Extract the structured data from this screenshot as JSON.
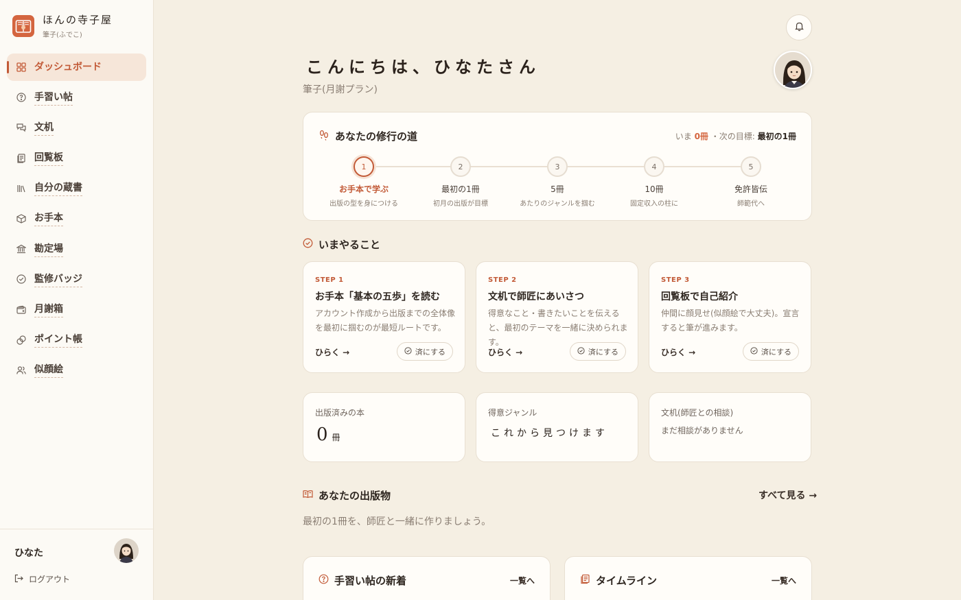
{
  "brand": {
    "name": "ほんの寺子屋",
    "subtitle": "筆子(ふでこ)"
  },
  "sidebar": {
    "items": [
      {
        "label": "ダッシュボード",
        "icon": "dashboard-icon",
        "active": true
      },
      {
        "label": "手習い帖",
        "icon": "question-bubble-icon"
      },
      {
        "label": "文机",
        "icon": "chat-bubbles-icon"
      },
      {
        "label": "回覧板",
        "icon": "documents-icon"
      },
      {
        "label": "自分の蔵書",
        "icon": "bookshelf-icon"
      },
      {
        "label": "お手本",
        "icon": "cube-icon"
      },
      {
        "label": "勘定場",
        "icon": "bank-icon"
      },
      {
        "label": "監修バッジ",
        "icon": "check-circle-icon"
      },
      {
        "label": "月謝箱",
        "icon": "wallet-icon"
      },
      {
        "label": "ポイント帳",
        "icon": "coins-icon"
      },
      {
        "label": "似顔絵",
        "icon": "users-icon"
      }
    ],
    "user_name": "ひなた",
    "logout_label": "ログアウト"
  },
  "header": {
    "greeting": "こんにちは、ひなたさん",
    "plan": "筆子(月謝プラン)"
  },
  "path": {
    "title": "あなたの修行の道",
    "status_prefix": "いま",
    "status_count": "0冊",
    "status_sep": "・次の目標:",
    "status_goal": "最初の1冊",
    "milestones": [
      {
        "num": "1",
        "title": "お手本で学ぶ",
        "sub": "出版の型を身につける"
      },
      {
        "num": "2",
        "title": "最初の1冊",
        "sub": "初月の出版が目標"
      },
      {
        "num": "3",
        "title": "5冊",
        "sub": "あたりのジャンルを掴む"
      },
      {
        "num": "4",
        "title": "10冊",
        "sub": "固定収入の柱に"
      },
      {
        "num": "5",
        "title": "免許皆伝",
        "sub": "師範代へ"
      }
    ],
    "current_step": 1
  },
  "todo": {
    "title": "いまやること",
    "steps": [
      {
        "label": "STEP 1",
        "title": "お手本「基本の五歩」を読む",
        "desc": "アカウント作成から出版までの全体像を最初に掴むのが最短ルートです。",
        "open": "ひらく →",
        "done": "済にする"
      },
      {
        "label": "STEP 2",
        "title": "文机で師匠にあいさつ",
        "desc": "得意なこと・書きたいことを伝えると、最初のテーマを一緒に決められます。",
        "open": "ひらく →",
        "done": "済にする"
      },
      {
        "label": "STEP 3",
        "title": "回覧板で自己紹介",
        "desc": "仲間に顔見せ(似顔絵で大丈夫)。宣言すると筆が進みます。",
        "open": "ひらく →",
        "done": "済にする"
      }
    ]
  },
  "stats": {
    "published_label": "出版済みの本",
    "published_value": "0",
    "published_unit": "冊",
    "genre_label": "得意ジャンル",
    "genre_value": "これから見つけます",
    "desk_label": "文机(師匠との相談)",
    "desk_value": "まだ相談がありません"
  },
  "publications": {
    "title": "あなたの出版物",
    "see_all": "すべて見る →",
    "desc": "最初の1冊を、師匠と一緒に作りましょう。"
  },
  "bottom": {
    "notebook_title": "手習い帖の新着",
    "notebook_link": "一覧へ",
    "timeline_title": "タイムライン",
    "timeline_link": "一覧へ"
  },
  "colors": {
    "accent": "#c25a37",
    "background": "#f5efe3",
    "card": "#fffdf9"
  }
}
